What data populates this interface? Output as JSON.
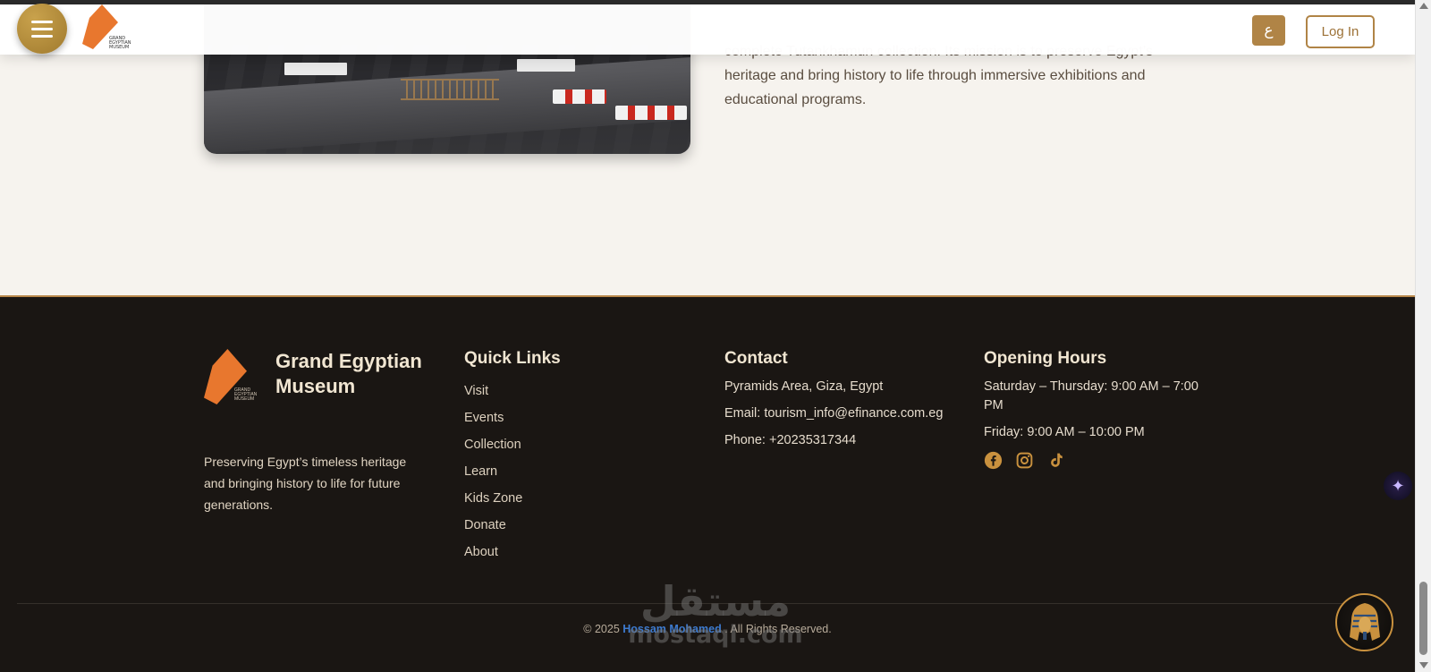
{
  "header": {
    "menu_icon": "hamburger-icon",
    "logo_caption": "GRAND EGYPTIAN MUSEUM",
    "lang_label": "ع",
    "login_label": "Log In"
  },
  "about": {
    "text": "complete Tutankhamun collection. Its mission is to preserve Egypt’s heritage and bring history to life through immersive exhibitions and educational programs."
  },
  "footer": {
    "brand": {
      "name": "Grand Egyptian Museum",
      "logo_caption": "GRAND EGYPTIAN MUSEUM",
      "description": "Preserving Egypt’s timeless heritage and bringing history to life for future generations."
    },
    "quick_links": {
      "title": "Quick Links",
      "items": [
        "Visit",
        "Events",
        "Collection",
        "Learn",
        "Kids Zone",
        "Donate",
        "About"
      ]
    },
    "contact": {
      "title": "Contact",
      "address": "Pyramids Area, Giza, Egypt",
      "email": "Email: tourism_info@efinance.com.eg",
      "phone": "Phone: +20235317344"
    },
    "hours": {
      "title": "Opening Hours",
      "weekdays": "Saturday – Thursday: 9:00 AM – 7:00 PM",
      "friday": "Friday: 9:00 AM – 10:00 PM",
      "social": [
        "facebook-icon",
        "instagram-icon",
        "tiktok-icon"
      ]
    },
    "copyright": {
      "prefix": "© 2025",
      "author": "Hossam Mohamed",
      "suffix": ". All Rights Reserved."
    }
  },
  "watermark": {
    "arabic": "مستقل",
    "latin": "mostaql.com"
  },
  "colors": {
    "accent_gold": "#b08446",
    "footer_bg": "#1a1613",
    "logo_orange": "#e8772e",
    "link_blue": "#3d7bd0"
  }
}
